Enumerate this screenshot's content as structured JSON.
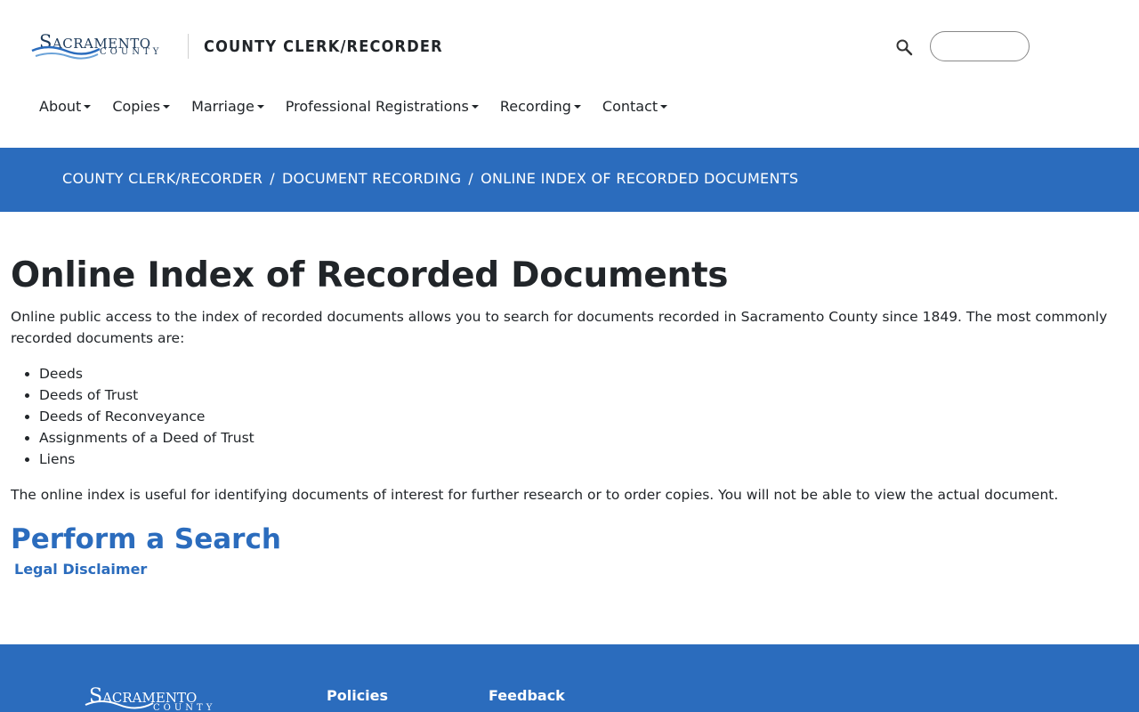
{
  "header": {
    "logo_text": "Sacramento",
    "logo_subtext": "COUNTY",
    "department": "COUNTY CLERK/RECORDER",
    "search_placeholder": ""
  },
  "nav": [
    {
      "label": "About"
    },
    {
      "label": "Copies"
    },
    {
      "label": "Marriage"
    },
    {
      "label": "Professional Registrations"
    },
    {
      "label": "Recording"
    },
    {
      "label": "Contact"
    }
  ],
  "breadcrumb": {
    "items": [
      "COUNTY CLERK/RECORDER",
      "DOCUMENT RECORDING",
      "ONLINE INDEX OF RECORDED DOCUMENTS"
    ],
    "separator": "/"
  },
  "main": {
    "title": "Online Index of Recorded Documents",
    "intro": "Online public access to the index of recorded documents allows you to search for documents recorded in Sacramento County since 1849. The most commonly recorded documents are:",
    "documents": [
      "Deeds",
      "Deeds of Trust",
      "Deeds of Reconveyance",
      "Assignments of a Deed of Trust",
      "Liens"
    ],
    "note": "The online index is useful for identifying documents of interest for further research or to order copies. You will not be able to view the actual document.",
    "search_link": "Perform a Search",
    "disclaimer_link": "Legal Disclaimer"
  },
  "footer": {
    "logo_text": "Sacramento",
    "logo_subtext": "COUNTY",
    "headings": [
      "Policies",
      "Feedback"
    ]
  },
  "colors": {
    "brand_blue": "#2b6cbd",
    "text": "#212529",
    "logo_navy": "#1d3a5a"
  },
  "icons": {
    "search": "search-icon",
    "nav_caret": "caret-down-icon",
    "logo_wave": "wave-icon"
  }
}
